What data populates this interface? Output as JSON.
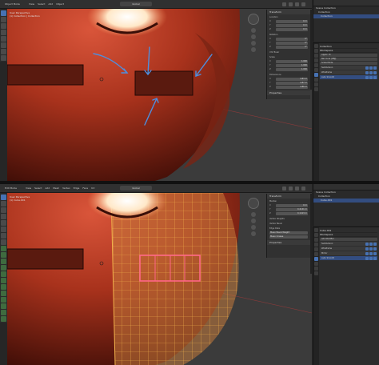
{
  "colors": {
    "accent": "#4772b3",
    "selection": "#334d80",
    "mesh_red": "#a8321c",
    "wire_orange": "#e8a23a",
    "face_select": "#ff6688",
    "arrow_blue": "#4d8fe0"
  },
  "top": {
    "header": {
      "mode": "Object Mode",
      "menu": [
        "View",
        "Select",
        "Add",
        "Object"
      ],
      "shading": "Global"
    },
    "viewport_info": {
      "line1": "User Perspective",
      "line2": "(1) Collection | Collection"
    },
    "npanel": {
      "title": "Transform",
      "sections": [
        {
          "name": "Location",
          "rows": [
            [
              "X",
              "0 m"
            ],
            [
              "Y",
              "0 m"
            ],
            [
              "Z",
              "0 m"
            ]
          ]
        },
        {
          "name": "Rotation",
          "rows": [
            [
              "X",
              "0°"
            ],
            [
              "Y",
              "0°"
            ],
            [
              "Z",
              "0°"
            ]
          ]
        },
        {
          "name": "XYZ Euler",
          "rows": []
        },
        {
          "name": "Scale",
          "rows": [
            [
              "X",
              "1.000"
            ],
            [
              "Y",
              "1.000"
            ],
            [
              "Z",
              "1.000"
            ]
          ]
        },
        {
          "name": "Dimensions",
          "rows": [
            [
              "X",
              "4.83 m"
            ],
            [
              "Y",
              "4.87 m"
            ],
            [
              "Z",
              "4.86 m"
            ]
          ]
        }
      ],
      "footer": "Properties"
    },
    "outliner": {
      "rows": [
        "Scene Collection",
        "Collection",
        "Collection"
      ]
    },
    "props": {
      "object_name": "Collection",
      "section": "Workspace",
      "list": [
        "Applic. M",
        "Rel. tuna (OBJ)",
        "Scale Mode",
        "Subdivision",
        "Wireframe",
        "Auto Smooth"
      ]
    }
  },
  "bottom": {
    "header": {
      "mode": "Edit Mode",
      "menu": [
        "View",
        "Select",
        "Add",
        "Mesh",
        "Vertex",
        "Edge",
        "Face",
        "UV"
      ],
      "shading": "Global"
    },
    "viewport_info": {
      "line1": "User Perspective",
      "line2": "(1) Cube.001"
    },
    "npanel": {
      "title": "Transform",
      "sections": [
        {
          "name": "Median",
          "rows": [
            [
              "X",
              "0 m"
            ],
            [
              "Y",
              "0.4141 m"
            ],
            [
              "Z",
              "0.1413 m"
            ]
          ]
        },
        {
          "name": "Vertex Weights",
          "rows": []
        },
        {
          "name": "Vertex Bevel",
          "rows": []
        },
        {
          "name": "Edge Data",
          "rows": [
            [
              "",
              "Mean Bevel Weight"
            ],
            [
              "",
              "Mean Crease"
            ]
          ]
        }
      ],
      "footer": "Properties"
    },
    "outliner": {
      "rows": [
        "Scene Collection",
        "Collection",
        "Cube.001"
      ]
    },
    "props": {
      "object_name": "Cube.001",
      "section": "Workspace",
      "list": [
        "Add Modifier",
        "Subdivision",
        "Wireframe",
        "Mirror",
        "Auto Smooth"
      ]
    }
  }
}
